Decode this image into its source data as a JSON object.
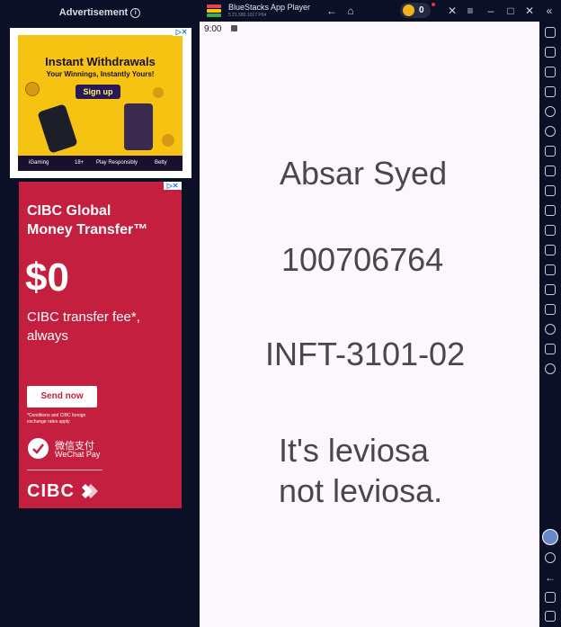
{
  "titlebar": {
    "app_title": "BlueStacks App Player",
    "version": "5.21.580.1017 P64",
    "coin_count": "0"
  },
  "ad_panel": {
    "header": "Advertisement",
    "info_glyph": "i",
    "ad1": {
      "title": "Instant Withdrawals",
      "subtitle": "Your Winnings, Instantly Yours!",
      "button": "Sign up",
      "footer_brand": "iGaming",
      "footer_age": "18+",
      "footer_note": "Play Responsibly",
      "footer_logo": "Betty"
    },
    "ad2": {
      "title": "CIBC Global\nMoney Transfer™",
      "amount": "$0",
      "subtitle": "CIBC transfer fee*,\nalways",
      "button": "Send now",
      "footnote": "*Conditions and CIBC foreign\nexchange rates apply",
      "wechat_cn": "微信支付",
      "wechat_en": "WeChat Pay",
      "logo": "CIBC"
    },
    "adchoices": "▷✕"
  },
  "screen": {
    "status_time": "9:00",
    "name": "Absar Syed",
    "student_id": "100706764",
    "course": "INFT-3101-02",
    "quote": "It's leviosa\nnot leviosa."
  },
  "colors": {
    "frame": "#0b1026",
    "screen_bg": "#fcf7fc",
    "text": "#4a464f",
    "cibc_red": "#c41f3e",
    "ad_yellow": "#f6c312"
  }
}
